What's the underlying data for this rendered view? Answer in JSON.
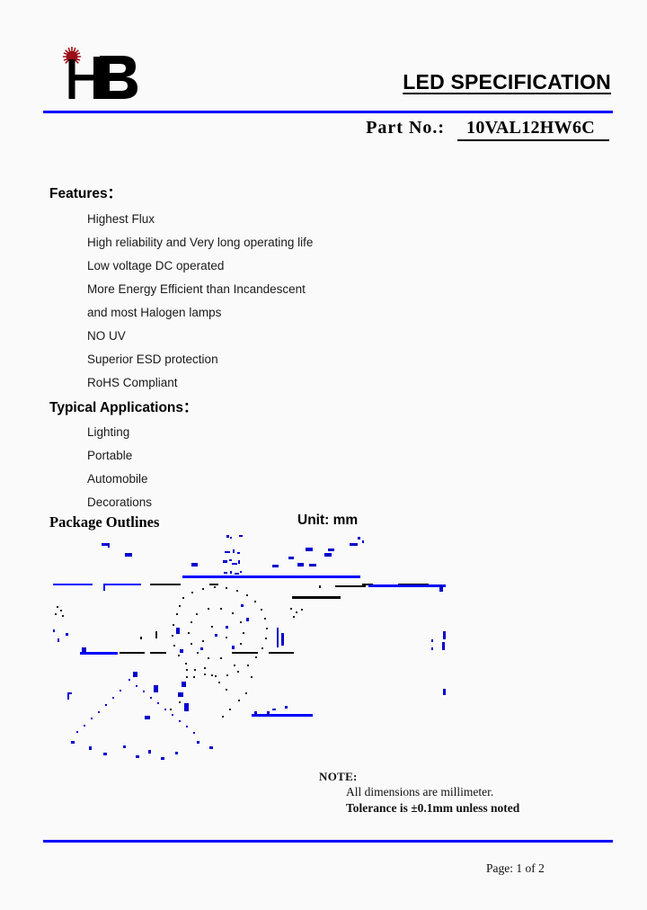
{
  "document": {
    "title": "LED SPECIFICATION",
    "part_label": "Part  No.:",
    "part_number": "10VAL12HW6C",
    "accent_blue": "#0000FF",
    "logo_red": "#9B0F16",
    "logo_text": "HB"
  },
  "features": {
    "heading": "Features：",
    "items": [
      "Highest Flux",
      "High reliability and Very long operating life",
      "Low voltage DC operated",
      "More Energy Efficient than Incandescent",
      "and most Halogen lamps",
      "NO UV",
      "Superior ESD protection",
      "RoHS Compliant"
    ]
  },
  "applications": {
    "heading": "Typical Applications：",
    "items": [
      "Lighting",
      "Portable",
      "Automobile",
      "Decorations"
    ]
  },
  "package": {
    "heading": "Package Outlines",
    "unit": "Unit: mm"
  },
  "note": {
    "title": "NOTE:",
    "line1": "All dimensions are millimeter.",
    "line2": "Tolerance is  ±0.1mm unless noted"
  },
  "footer": {
    "page": "Page: 1 of 2"
  }
}
